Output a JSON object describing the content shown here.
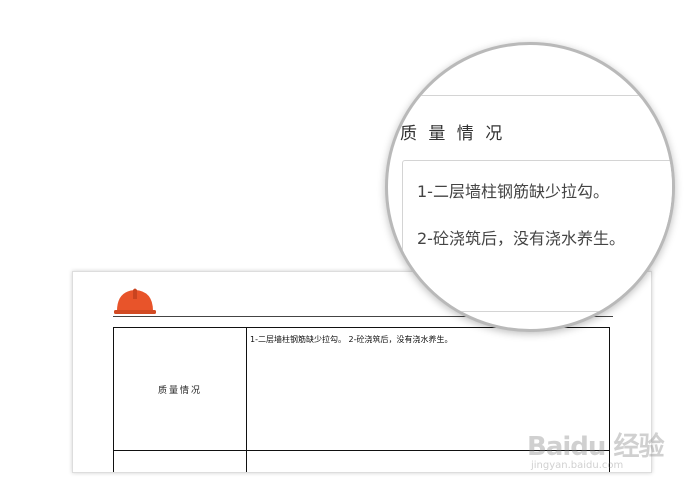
{
  "document": {
    "label": "质量情况",
    "content": "1-二层墙柱钢筋缺少拉勾。 2-砼浇筑后，没有浇水养生。"
  },
  "zoom": {
    "label": "质 量 情 况",
    "line1": "1-二层墙柱钢筋缺少拉勾。",
    "line2": "2-砼浇筑后，没有浇水养生。"
  },
  "watermark": {
    "main": "Baidu 经验",
    "sub": "jingyan.baidu.com"
  },
  "colors": {
    "helmet": "#e8542a",
    "table_border": "#111111",
    "magnifier_border": "#b9b9b9"
  },
  "icons": {
    "logo": "hard-hat-icon"
  }
}
